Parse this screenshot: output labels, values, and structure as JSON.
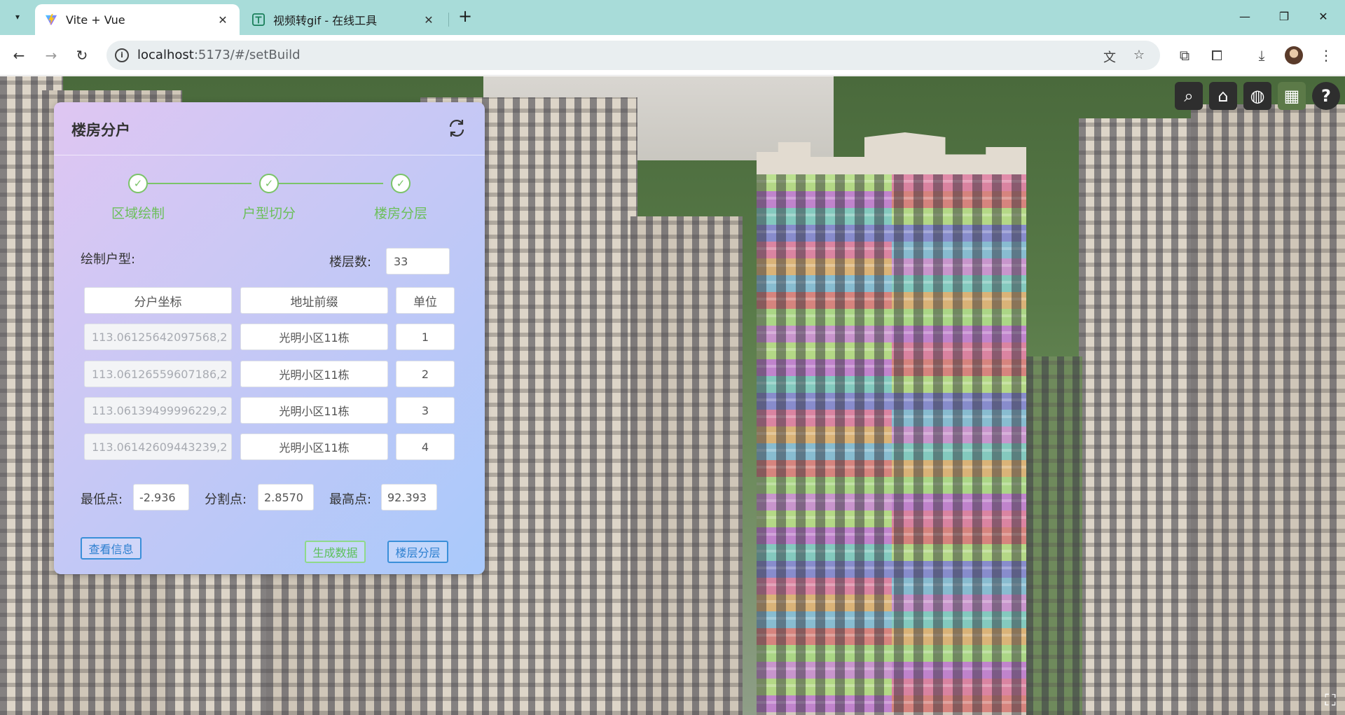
{
  "browser": {
    "tabs": [
      {
        "title": "Vite + Vue",
        "active": true,
        "favicon": "vite-logo-icon"
      },
      {
        "title": "视频转gif - 在线工具",
        "active": false,
        "favicon": "tool-logo-icon"
      }
    ],
    "url_host": "localhost",
    "url_rest": ":5173/#/setBuild"
  },
  "panel": {
    "title": "楼房分户",
    "steps": [
      {
        "label": "区域绘制"
      },
      {
        "label": "户型切分"
      },
      {
        "label": "楼房分层"
      }
    ],
    "draw_label": "绘制户型:",
    "floor_count_label": "楼层数:",
    "floor_count_value": "33",
    "table": {
      "headers": [
        "分户坐标",
        "地址前缀",
        "单位"
      ],
      "rows": [
        {
          "coord": "113.06125642097568,2",
          "prefix": "光明小区11栋",
          "unit": "1"
        },
        {
          "coord": "113.06126559607186,2",
          "prefix": "光明小区11栋",
          "unit": "2"
        },
        {
          "coord": "113.06139499996229,2",
          "prefix": "光明小区11栋",
          "unit": "3"
        },
        {
          "coord": "113.06142609443239,2",
          "prefix": "光明小区11栋",
          "unit": "4"
        }
      ]
    },
    "min_label": "最低点:",
    "min_value": "-2.936",
    "split_label": "分割点:",
    "split_value": "2.8570",
    "max_label": "最高点:",
    "max_value": "92.393",
    "buttons": {
      "view_info": "查看信息",
      "generate": "生成数据",
      "layer": "楼层分层"
    }
  },
  "colors": {
    "step_green": "#7bc469",
    "button_blue": "#3a8fd9"
  }
}
